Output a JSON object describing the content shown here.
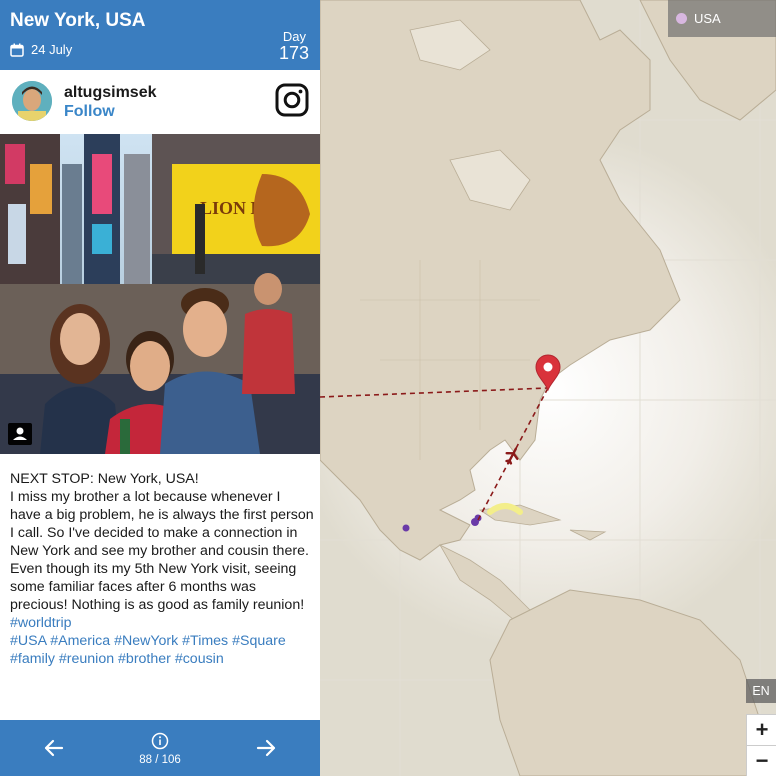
{
  "header": {
    "location": "New York, USA",
    "date": "24 July",
    "day_label": "Day",
    "day_number": "173"
  },
  "post": {
    "username": "altugsimsek",
    "follow_label": "Follow",
    "text_lines": [
      "NEXT STOP: New York, USA!",
      "I miss my brother a lot because whenever I have a big problem, he is always the first person I call. So I've decided to make a connection in New York and see my brother and cousin there. Even though its my 5th New York visit, seeing some familiar faces after 6 months was precious! Nothing is as good as family reunion!"
    ],
    "hashtag_lines": [
      "#worldtrip",
      "#USA #America #NewYork #Times #Square",
      "#family #reunion #brother #cousin"
    ]
  },
  "footer": {
    "counter": "88 / 106"
  },
  "map": {
    "legend_label": "USA",
    "legend_color": "#d8b7e0",
    "language": "EN",
    "zoom_in": "+",
    "zoom_out": "−",
    "route_color": "#8b1a1a",
    "marker_color": "#d9323b"
  },
  "icons": [
    "calendar-icon",
    "instagram-icon",
    "user-icon",
    "arrow-left-icon",
    "info-icon",
    "arrow-right-icon",
    "map-pin-icon",
    "airplane-icon"
  ]
}
